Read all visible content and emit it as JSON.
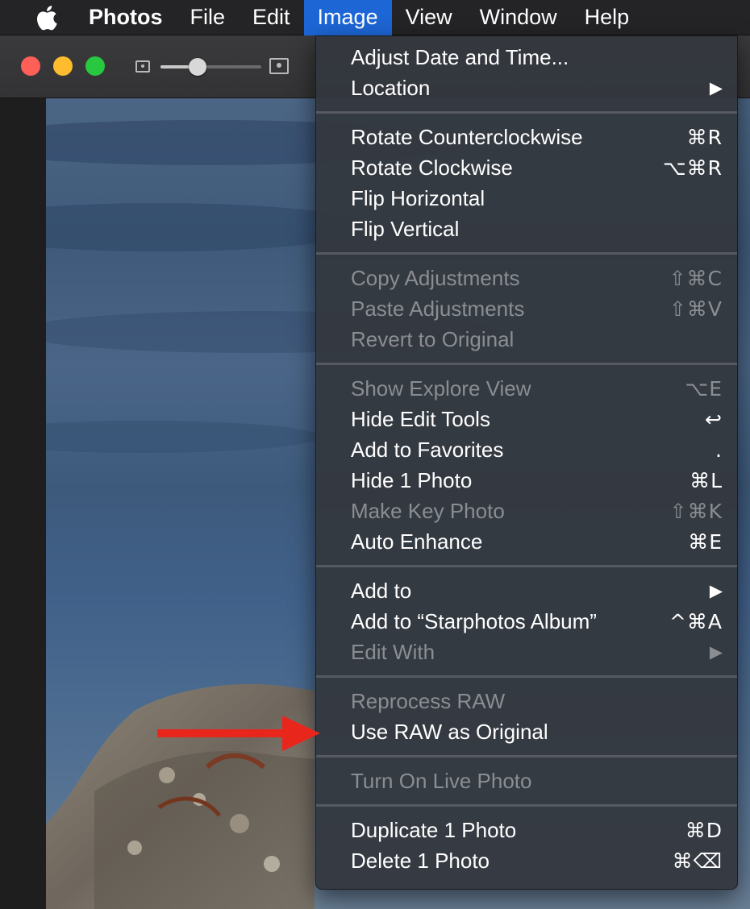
{
  "menubar": {
    "app": "Photos",
    "items": [
      "File",
      "Edit",
      "Image",
      "View",
      "Window",
      "Help"
    ],
    "active_color": "#1d66d6"
  },
  "window": {
    "traffic_lights": [
      "#fe5f57",
      "#febc2e",
      "#28c840"
    ],
    "zoom_slider_value": 0.37
  },
  "image_menu": {
    "group1": [
      {
        "label": "Adjust Date and Time...",
        "shortcut": "",
        "submenu": false,
        "enabled": true
      },
      {
        "label": "Location",
        "shortcut": "▶",
        "submenu": true,
        "enabled": true
      }
    ],
    "group2": [
      {
        "label": "Rotate Counterclockwise",
        "shortcut": "⌘R",
        "enabled": true
      },
      {
        "label": "Rotate Clockwise",
        "shortcut": "⌥⌘R",
        "enabled": true
      },
      {
        "label": "Flip Horizontal",
        "shortcut": "",
        "enabled": true
      },
      {
        "label": "Flip Vertical",
        "shortcut": "",
        "enabled": true
      }
    ],
    "group3": [
      {
        "label": "Copy Adjustments",
        "shortcut": "⇧⌘C",
        "enabled": false
      },
      {
        "label": "Paste Adjustments",
        "shortcut": "⇧⌘V",
        "enabled": false
      },
      {
        "label": "Revert to Original",
        "shortcut": "",
        "enabled": false
      }
    ],
    "group4": [
      {
        "label": "Show Explore View",
        "shortcut": "⌥E",
        "enabled": false
      },
      {
        "label": "Hide Edit Tools",
        "shortcut": "↩",
        "enabled": true
      },
      {
        "label": "Add to Favorites",
        "shortcut": ".",
        "enabled": true
      },
      {
        "label": "Hide 1 Photo",
        "shortcut": "⌘L",
        "enabled": true
      },
      {
        "label": "Make Key Photo",
        "shortcut": "⇧⌘K",
        "enabled": false
      },
      {
        "label": "Auto Enhance",
        "shortcut": "⌘E",
        "enabled": true
      }
    ],
    "group5": [
      {
        "label": "Add to",
        "shortcut": "▶",
        "submenu": true,
        "enabled": true
      },
      {
        "label": "Add to “Starphotos Album”",
        "shortcut": "^⌘A",
        "enabled": true
      },
      {
        "label": "Edit With",
        "shortcut": "▶",
        "submenu": true,
        "enabled": false
      }
    ],
    "group6": [
      {
        "label": "Reprocess RAW",
        "shortcut": "",
        "enabled": false
      },
      {
        "label": "Use RAW as Original",
        "shortcut": "",
        "enabled": true
      }
    ],
    "group7": [
      {
        "label": "Turn On Live Photo",
        "shortcut": "",
        "enabled": false
      }
    ],
    "group8": [
      {
        "label": "Duplicate 1 Photo",
        "shortcut": "⌘D",
        "enabled": true
      },
      {
        "label": "Delete 1 Photo",
        "shortcut": "⌘⌫",
        "enabled": true
      }
    ]
  },
  "annotation": {
    "arrow_color": "#e8261c"
  },
  "icons": {
    "apple": "apple-logo-icon",
    "zoom_small": "small-thumbnail-icon",
    "zoom_large": "large-thumbnail-icon",
    "submenu": "submenu-arrow-icon"
  }
}
